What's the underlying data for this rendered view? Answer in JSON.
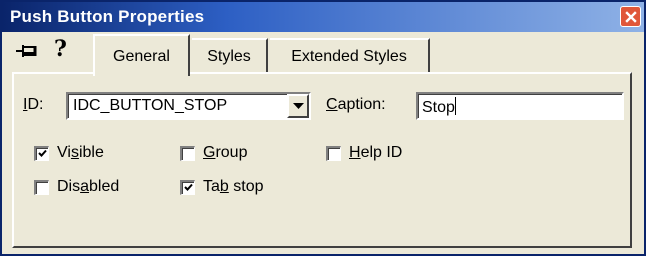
{
  "window": {
    "title": "Push Button Properties"
  },
  "tabs": [
    {
      "label": "General",
      "selected": true
    },
    {
      "label": "Styles",
      "selected": false
    },
    {
      "label": "Extended Styles",
      "selected": false
    }
  ],
  "general": {
    "id_label_prefix": "",
    "id_label_mnemonic": "I",
    "id_label_rest": "D:",
    "id_value": "IDC_BUTTON_STOP",
    "caption_label_mnemonic": "C",
    "caption_label_rest": "aption:",
    "caption_value": "Stop",
    "checkboxes": [
      {
        "pre": "Vi",
        "mn": "s",
        "post": "ible",
        "checked": true
      },
      {
        "pre": "",
        "mn": "G",
        "post": "roup",
        "checked": false
      },
      {
        "pre": "",
        "mn": "H",
        "post": "elp ID",
        "checked": false
      },
      {
        "pre": "Dis",
        "mn": "a",
        "post": "bled",
        "checked": false
      },
      {
        "pre": "Ta",
        "mn": "b",
        "post": " stop",
        "checked": true
      }
    ]
  },
  "icons": {
    "pin": "pushpin-icon",
    "help": "help-question-icon",
    "close": "close-x-icon",
    "dropdown": "dropdown-arrow-icon"
  }
}
